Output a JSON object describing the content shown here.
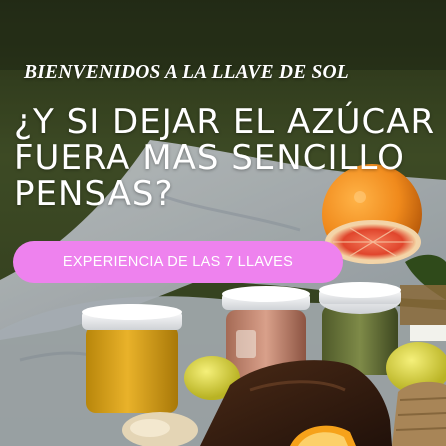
{
  "hero": {
    "tagline": "BIENVENIDOS A LA LLAVE DE SOL",
    "headline_lines": [
      "¿Y SI DEJAR EL AZÚCAR",
      "FUERA MAS SENCILLO",
      "PENSAS?"
    ],
    "cta_label": "EXPERIENCIA DE LAS 7 LLAVES"
  },
  "colors": {
    "cta_background": "#ee82ee",
    "text": "#ffffff",
    "grass": "#4a5a2c"
  }
}
